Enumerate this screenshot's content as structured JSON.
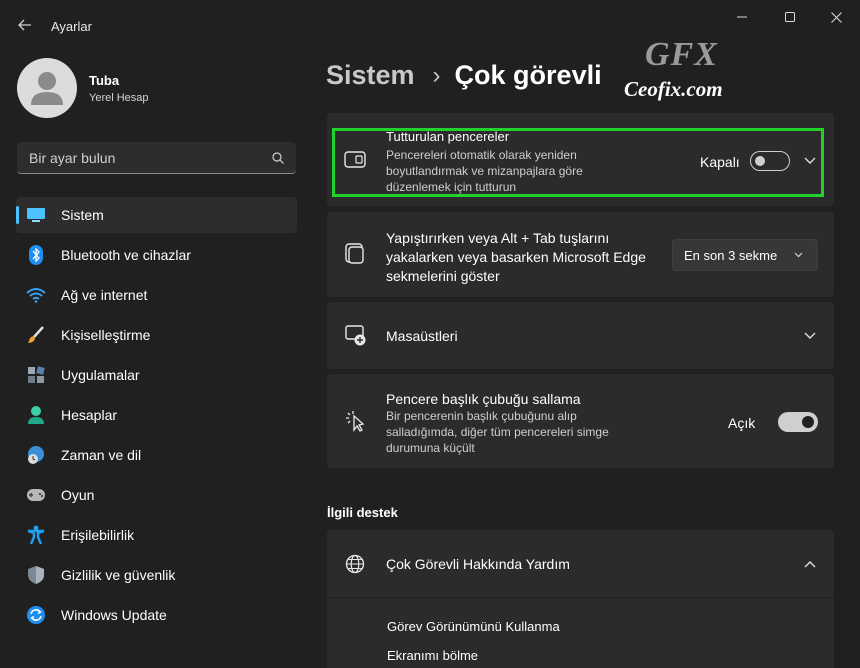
{
  "window": {
    "title": "Ayarlar",
    "minimize_icon": "minimize-icon",
    "maximize_icon": "maximize-icon",
    "close_icon": "close-icon"
  },
  "user": {
    "name": "Tuba",
    "account_type": "Yerel Hesap"
  },
  "search": {
    "placeholder": "Bir ayar bulun"
  },
  "sidebar": {
    "items": [
      {
        "label": "Sistem",
        "icon": "monitor-icon",
        "active": true
      },
      {
        "label": "Bluetooth ve cihazlar",
        "icon": "bluetooth-icon"
      },
      {
        "label": "Ağ ve internet",
        "icon": "wifi-icon"
      },
      {
        "label": "Kişiselleştirme",
        "icon": "brush-icon"
      },
      {
        "label": "Uygulamalar",
        "icon": "apps-icon"
      },
      {
        "label": "Hesaplar",
        "icon": "person-icon"
      },
      {
        "label": "Zaman ve dil",
        "icon": "globe-clock-icon"
      },
      {
        "label": "Oyun",
        "icon": "gamepad-icon"
      },
      {
        "label": "Erişilebilirlik",
        "icon": "accessibility-icon"
      },
      {
        "label": "Gizlilik ve güvenlik",
        "icon": "shield-icon"
      },
      {
        "label": "Windows Update",
        "icon": "update-icon"
      }
    ]
  },
  "breadcrumb": {
    "parent": "Sistem",
    "separator": "›",
    "current": "Çok görevli"
  },
  "watermark": {
    "logo": "GFX",
    "text": "Ceofix.com"
  },
  "settings": {
    "snap": {
      "title": "Tutturulan pencereler",
      "desc_lines": [
        "Pencereleri otomatik olarak yeniden",
        "boyutlandırmak ve mizanpajlara göre",
        "düzenlemek için tutturun"
      ],
      "state": "Kapalı",
      "highlight_color": "#22d12c"
    },
    "alt_tab": {
      "title_lines": [
        "Yapıştırırken veya Alt + Tab tuşlarını",
        "yakalarken veya basarken Microsoft Edge",
        "sekmelerini göster"
      ],
      "selected": "En son 3 sekme"
    },
    "desktops": {
      "title": "Masaüstleri"
    },
    "shake": {
      "title": "Pencere başlık çubuğu sallama",
      "desc_lines": [
        "Bir pencerenin başlık çubuğunu alıp",
        "salladığımda, diğer tüm pencereleri simge",
        "durumuna küçült"
      ],
      "state": "Açık"
    }
  },
  "related": {
    "heading": "İlgili destek",
    "help_title": "Çok Görevli Hakkında Yardım",
    "links": [
      "Görev Görünümünü Kullanma",
      "Ekranımı bölme"
    ]
  },
  "colors": {
    "background": "#202020",
    "card": "#2b2b2b",
    "accent": "#4cc2ff"
  }
}
